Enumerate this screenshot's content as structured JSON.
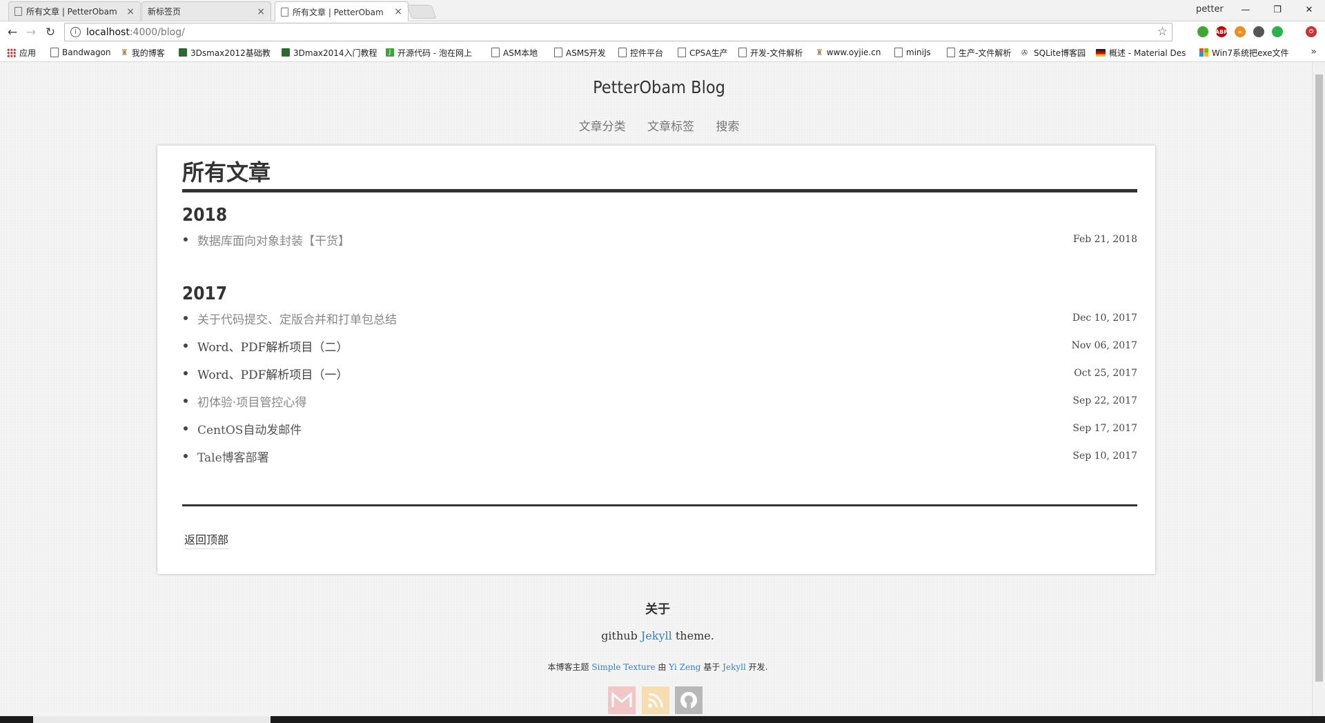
{
  "browser": {
    "tabs": [
      {
        "title": "所有文章 | PetterObam",
        "close": "×"
      },
      {
        "title": "新标签页",
        "close": "×"
      },
      {
        "title": "所有文章 | PetterObam",
        "close": "×"
      }
    ],
    "profile_name": "petter",
    "url_host": "localhost",
    "url_path": ":4000/blog/",
    "bookmarks": [
      "应用",
      "Bandwagon",
      "我的博客",
      "3Dsmax2012基础教",
      "3Dmax2014入门教程",
      "开源代码 - 泡在网上",
      "ASM本地",
      "ASMS开发",
      "控件平台",
      "CPSA生产",
      "开发-文件解析",
      "www.oyjie.cn",
      "miniJs",
      "生产-文件解析",
      "SQLite博客园",
      "概述 - Material Des",
      "Win7系统把exe文件"
    ],
    "extensions": [
      {
        "name": "green-apple-icon",
        "color": "#3fa535",
        "text": ""
      },
      {
        "name": "adblock-icon",
        "color": "#cc0000",
        "text": "ABP"
      },
      {
        "name": "infinity-icon",
        "color": "#f08a1c",
        "text": "∞"
      },
      {
        "name": "chart-icon",
        "color": "#555555",
        "text": ""
      },
      {
        "name": "shield-icon",
        "color": "#2ab24c",
        "text": ""
      },
      {
        "name": "power-icon",
        "color": "#d23030",
        "text": "⏻"
      }
    ]
  },
  "site": {
    "title": "PetterObam Blog",
    "nav": [
      "文章分类",
      "文章标签",
      "搜索"
    ]
  },
  "archive": {
    "heading": "所有文章",
    "years": [
      {
        "year": "2018",
        "posts": [
          {
            "title": "数据库面向对象封装【干货】",
            "date": "Feb 21, 2018"
          }
        ]
      },
      {
        "year": "2017",
        "posts": [
          {
            "title": "关于代码提交、定版合并和打单包总结",
            "date": "Dec 10, 2017"
          },
          {
            "title": "Word、PDF解析项目（二）",
            "date": "Nov 06, 2017"
          },
          {
            "title": "Word、PDF解析项目（一）",
            "date": "Oct 25, 2017"
          },
          {
            "title": "初体验·项目管控心得",
            "date": "Sep 22, 2017"
          },
          {
            "title": "CentOS自动发邮件",
            "date": "Sep 17, 2017"
          },
          {
            "title": "Tale博客部署",
            "date": "Sep 10, 2017"
          }
        ]
      }
    ],
    "back_to_top": "返回顶部"
  },
  "footer": {
    "about_heading": "关于",
    "line1_pre": "github",
    "line1_link": "Jekyll",
    "line1_post": "theme.",
    "line2_a": "本博客主题",
    "line2_link1": "Simple Texture",
    "line2_b": "由",
    "line2_link2": "Yi Zeng",
    "line2_c": "基于",
    "line2_link3": "Jekyll",
    "line2_d": "开发."
  },
  "colors": {
    "link": "#3a7ec0",
    "text": "#333333",
    "muted": "#888888"
  }
}
